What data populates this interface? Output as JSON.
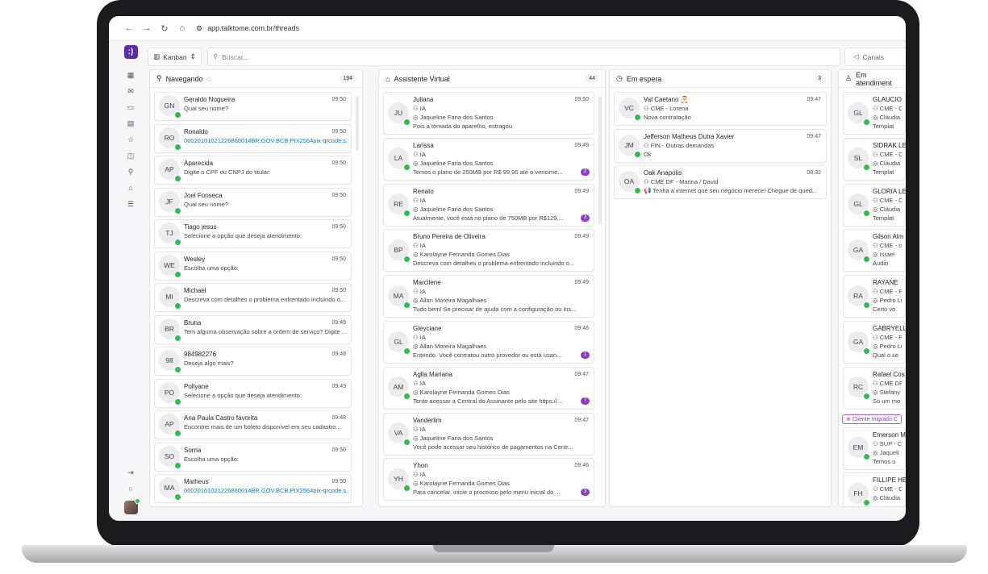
{
  "browser": {
    "url": "app.talktome.com.br/threads",
    "back": "←",
    "forward": "→",
    "reload": "↻",
    "home": "⌂"
  },
  "topbar": {
    "view": "Kanban",
    "search_placeholder": "Buscar...",
    "channels": "Canais"
  },
  "logo": ":)",
  "columns": [
    {
      "title": "Navegando",
      "count": "194",
      "cards": [
        {
          "initials": "GN",
          "name": "Geraldo Nogueira",
          "time": "09:50",
          "lines": [
            "Qual seu nome?"
          ]
        },
        {
          "initials": "RO",
          "name": "Ronaldo",
          "time": "09:50",
          "lines": [
            "00020101021226860014BR.GOV.BCB.PIX2564pix-qrcode.s..."
          ],
          "link": true
        },
        {
          "initials": "AP",
          "name": "Aparecida",
          "time": "09:50",
          "lines": [
            "Digite o CPF ou CNPJ do titular:"
          ]
        },
        {
          "initials": "JF",
          "name": "Joel Fonseca",
          "time": "09:50",
          "lines": [
            "Qual seu nome?"
          ]
        },
        {
          "initials": "TJ",
          "name": "Tiago jesus",
          "time": "09:50",
          "lines": [
            "Selecione a opção que deseja atendimento:"
          ]
        },
        {
          "initials": "WE",
          "name": "Wesley",
          "time": "09:50",
          "lines": [
            "Escolha uma opção:"
          ]
        },
        {
          "initials": "MI",
          "name": "Michael",
          "time": "09:50",
          "lines": [
            "Descreva com detalhes o problema enfrentado incluindo o..."
          ]
        },
        {
          "initials": "BR",
          "name": "Bruna",
          "time": "09:49",
          "lines": [
            "Tem alguma observação sobre a ordem de serviço? Digite ..."
          ]
        },
        {
          "initials": "98",
          "name": "984982276",
          "time": "09:48",
          "lines": [
            "Deseja algo mais?"
          ]
        },
        {
          "initials": "PO",
          "name": "Pollyane",
          "time": "09:49",
          "lines": [
            "Selecione a opção que deseja atendimento:"
          ]
        },
        {
          "initials": "AP",
          "name": "Ana Paula Castro favorita",
          "time": "09:48",
          "lines": [
            "Encontrei mais de um boleto disponível em seu cadastro..."
          ]
        },
        {
          "initials": "SO",
          "name": "Sorria",
          "time": "09:50",
          "lines": [
            "Escolha uma opção:"
          ]
        },
        {
          "initials": "MA",
          "name": "Matheus",
          "time": "09:50",
          "lines": [
            "00020101021226860014BR.GOV.BCB.PIX2564pix-qrcode.s..."
          ],
          "link": true
        }
      ]
    },
    {
      "title": "Assistente Virtual",
      "count": "44",
      "cards": [
        {
          "initials": "JU",
          "name": "Juliana",
          "time": "09:50",
          "lines": [
            "IA",
            "Jaqueline Faria dos Santos",
            "Pois a tomada do aparelho, estragou"
          ]
        },
        {
          "initials": "LA",
          "name": "Larissa",
          "time": "09:49",
          "lines": [
            "IA",
            "Jaqueline Faria dos Santos",
            "Temos o plano de 250MB por R$ 99,90 até o vencime..."
          ],
          "badge": "2"
        },
        {
          "initials": "RE",
          "name": "Renato",
          "time": "09:49",
          "lines": [
            "IA",
            "Jaqueline Faria dos Santos",
            "Atualmente, você está no plano de 750MB por R$129,..."
          ],
          "badge": "3"
        },
        {
          "initials": "BP",
          "name": "Bruno Pereira de Oliveira",
          "time": "09:49",
          "lines": [
            "IA",
            "Karolayne Fernanda Gomes Dias",
            "Descreva com detalhes o problema enfrentado incluindo o..."
          ]
        },
        {
          "initials": "MA",
          "name": "Marcilene",
          "time": "09:49",
          "lines": [
            "IA",
            "Allan Moreira Magalhaes",
            "Tudo bem! Se precisar de ajuda com a configuração ou ins..."
          ]
        },
        {
          "initials": "GL",
          "name": "Gleyciane",
          "time": "09:48",
          "lines": [
            "IA",
            "Allan Moreira Magalhaes",
            "Entendo. Você contratou outro provedor ou está usan..."
          ],
          "badge": "1"
        },
        {
          "initials": "AM",
          "name": "Aglla Mariana",
          "time": "09:47",
          "lines": [
            "IA",
            "Karolayne Fernanda Gomes Dias",
            "Tente acessar a Central do Assinante pelo site https://..."
          ],
          "badge": "7"
        },
        {
          "initials": "VA",
          "name": "Vanderlim",
          "time": "09:47",
          "lines": [
            "IA",
            "Jaqueline Faria dos Santos",
            "Você pode acessar seu histórico de pagamentos na Centr..."
          ]
        },
        {
          "initials": "YH",
          "name": "Yhon",
          "time": "09:46",
          "lines": [
            "IA",
            "Karolayne Fernanda Gomes Dias",
            "Para cancelar, inicie o processo pelo menu inicial do ..."
          ],
          "badge": "3"
        }
      ]
    },
    {
      "title": "Em espera",
      "count": "3",
      "cards": [
        {
          "initials": "VC",
          "name": "Val Caetano 🎅",
          "time": "09:47",
          "lines": [
            "CME - Lorena",
            "Nova contratação"
          ]
        },
        {
          "initials": "JM",
          "name": "Jefferson Matheus Dutra Xavier",
          "time": "09:47",
          "lines": [
            "FIN - Outras demandas",
            "Ok"
          ]
        },
        {
          "initials": "OA",
          "name": "Oak Anapolis",
          "time": "08:32",
          "lines": [
            "CME DF - Marina / David",
            "📢 Tenha a internet que seu negócio merece! Chegue de qued..."
          ]
        }
      ]
    },
    {
      "title": "Em atendiment",
      "cards": [
        {
          "initials": "GL",
          "name": "GLAUCIO",
          "lines": [
            "CME - C",
            "Cláudia",
            "Templat"
          ]
        },
        {
          "initials": "SL",
          "name": "SIDRAK LEI",
          "lines": [
            "CME - C",
            "Cláudia",
            "Templat"
          ]
        },
        {
          "initials": "GL",
          "name": "GLORIA LE/",
          "lines": [
            "CME - C",
            "Cláudia",
            "Templat"
          ]
        },
        {
          "initials": "GA",
          "name": "Gilson Alm",
          "lines": [
            "CME - Is",
            "Israel",
            "Áudio"
          ]
        },
        {
          "initials": "RA",
          "name": "RAYANE",
          "lines": [
            "CME - P",
            "Pedro Lu",
            "Certo vo"
          ]
        },
        {
          "initials": "GA",
          "name": "GABRYELL",
          "lines": [
            "CME - P",
            "Pedro Lu",
            "Qual o se"
          ]
        },
        {
          "initials": "RC",
          "name": "Rafael Cos",
          "lines": [
            "CME DF",
            "Stefany",
            "Só um mo"
          ]
        },
        {
          "initials": "EM",
          "name": "Emerson M",
          "lines": [
            "SUP - C",
            "Jaqueli",
            "Temos u"
          ]
        },
        {
          "initials": "FH",
          "name": "FILLIPE HE",
          "lines": [
            "CME - C",
            "Cláudia",
            ""
          ]
        }
      ],
      "tag": "Cliente migrado C"
    }
  ]
}
